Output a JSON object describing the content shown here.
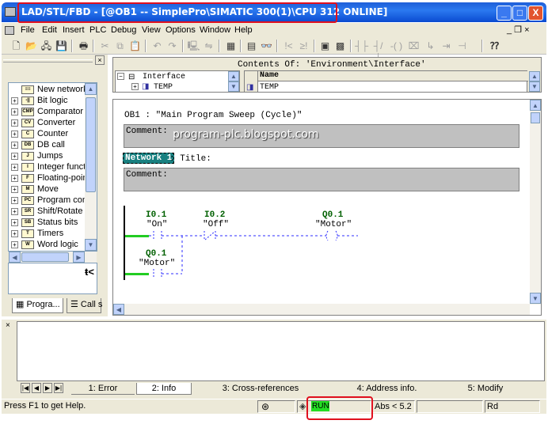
{
  "window": {
    "title": "LAD/STL/FBD  - [@OB1 -- SimplePro\\SIMATIC 300(1)\\CPU 312  ONLINE]",
    "min_glyph": "_",
    "max_glyph": "□",
    "close_glyph": "X"
  },
  "menu": {
    "items": [
      "File",
      "Edit",
      "Insert",
      "PLC",
      "Debug",
      "View",
      "Options",
      "Window",
      "Help"
    ],
    "mdi_controls": "_  ❐  ×"
  },
  "toolbar": {
    "buttons": [
      "new-icon",
      "open-icon",
      "network-icon",
      "save-icon",
      "print-icon",
      "cut-icon",
      "copy-icon",
      "paste-icon",
      "undo-icon",
      "redo-icon",
      "download-icon",
      "compare-icon",
      "overview-icon",
      "monitor-icon",
      "glasses-icon",
      "not-equal-icon",
      "not-equal2-icon",
      "detail-icon",
      "program-elements-icon",
      "contact-no-icon",
      "contact-nc-icon",
      "coil-icon",
      "box-icon",
      "branch-open-icon",
      "branch-close-icon",
      "jump-icon",
      "help-icon"
    ],
    "glyphs": [
      "🗋",
      "📂",
      "🖧",
      "💾",
      "🖶",
      "✂",
      "⧉",
      "📋",
      "↶",
      "↷",
      "🖳",
      "⇋",
      "▦",
      "▤",
      "👓",
      "!<",
      "≥!",
      "▣",
      "▩",
      "┤├",
      "┤/├",
      "-( )",
      "⌧",
      "↳",
      "⇥",
      "⊣",
      "⁇"
    ]
  },
  "left_pane": {
    "close_glyph": "×",
    "items": [
      {
        "label": "New network",
        "icon": "new-network-icon",
        "has_plus": false,
        "icon_text": "≡≡"
      },
      {
        "label": "Bit logic",
        "icon": "bit-logic-icon",
        "has_plus": true,
        "icon_text": "-||"
      },
      {
        "label": "Comparator",
        "icon": "comparator-icon",
        "has_plus": true,
        "icon_text": "CMP"
      },
      {
        "label": "Converter",
        "icon": "converter-icon",
        "has_plus": true,
        "icon_text": "CV"
      },
      {
        "label": "Counter",
        "icon": "counter-icon",
        "has_plus": true,
        "icon_text": "C"
      },
      {
        "label": "DB call",
        "icon": "db-call-icon",
        "has_plus": true,
        "icon_text": "DB"
      },
      {
        "label": "Jumps",
        "icon": "jumps-icon",
        "has_plus": true,
        "icon_text": "J"
      },
      {
        "label": "Integer functi",
        "icon": "integer-icon",
        "has_plus": true,
        "icon_text": "I"
      },
      {
        "label": "Floating-point",
        "icon": "floating-icon",
        "has_plus": true,
        "icon_text": "F"
      },
      {
        "label": "Move",
        "icon": "move-icon",
        "has_plus": true,
        "icon_text": "M"
      },
      {
        "label": "Program contr",
        "icon": "program-control-icon",
        "has_plus": true,
        "icon_text": "PC"
      },
      {
        "label": "Shift/Rotate",
        "icon": "shift-icon",
        "has_plus": true,
        "icon_text": "SR"
      },
      {
        "label": "Status bits",
        "icon": "status-bits-icon",
        "has_plus": true,
        "icon_text": "SB"
      },
      {
        "label": "Timers",
        "icon": "timers-icon",
        "has_plus": true,
        "icon_text": "T"
      },
      {
        "label": "Word logic",
        "icon": "word-logic-icon",
        "has_plus": true,
        "icon_text": "W"
      }
    ],
    "tabs": [
      {
        "label": "Progra...",
        "icon": "program-elements-tab-icon"
      },
      {
        "label": "Call s",
        "icon": "call-structure-tab-icon"
      }
    ],
    "symbol": "ŧ<"
  },
  "interface": {
    "contents_label": "Contents Of: 'Environment\\Interface'",
    "tree": [
      "Interface",
      "TEMP"
    ],
    "column_header": "Name",
    "rows": [
      "TEMP"
    ]
  },
  "code": {
    "block_header": "OB1 :  \"Main Program Sweep (Cycle)\"",
    "block_comment_label": "Comment:",
    "network_label": "Network 1",
    "network_title_label": ": Title:",
    "network_comment_label": "Comment:",
    "watermark": "program-plc.blogspot.com",
    "contacts": [
      {
        "address": "I0.1",
        "symbol": "\"On\""
      },
      {
        "address": "I0.2",
        "symbol": "\"Off\""
      },
      {
        "address": "Q0.1",
        "symbol": "\"Motor\""
      }
    ],
    "coil": {
      "address": "Q0.1",
      "symbol": "\"Motor\""
    }
  },
  "output": {
    "close_glyph": "×",
    "tabs": [
      "1: Error",
      "2: Info",
      "3: Cross-references",
      "4: Address info.",
      "5: Modify"
    ]
  },
  "status": {
    "help_text": "Press F1 to get Help.",
    "run": "RUN",
    "abs": "Abs < 5.2",
    "mode": "Rd"
  }
}
